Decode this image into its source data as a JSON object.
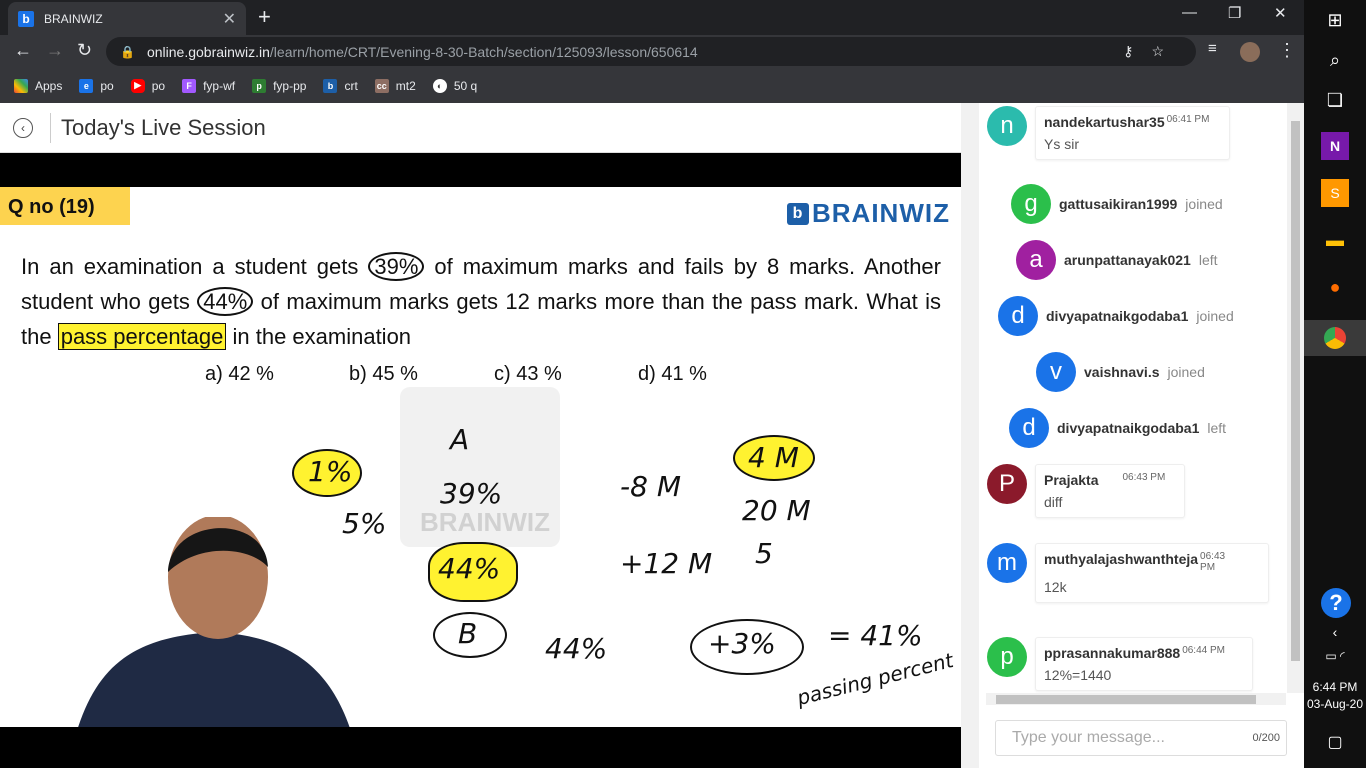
{
  "browser": {
    "tab_title": "BRAINWIZ",
    "tab_close": "✕",
    "new_tab": "+",
    "win_min": "—",
    "win_max": "❐",
    "win_close": "✕",
    "url_domain": "online.gobrainwiz.in",
    "url_path": "/learn/home/CRT/Evening-8-30-Batch/section/125093/lesson/650614",
    "bookmarks": [
      {
        "label": "Apps",
        "color": "#ea4335"
      },
      {
        "label": "po",
        "color": "#1a73e8"
      },
      {
        "label": "po",
        "color": "#ff0000"
      },
      {
        "label": "fyp-wf",
        "color": "#a259ff"
      },
      {
        "label": "fyp-pp",
        "color": "#2e7d32"
      },
      {
        "label": "crt",
        "color": "#1d5fa8"
      },
      {
        "label": "mt2",
        "color": "#8d6e63"
      },
      {
        "label": "50 q",
        "color": "#ffffff"
      }
    ]
  },
  "page": {
    "title": "Today's Live Session"
  },
  "board": {
    "qno": "Q no (19)",
    "brand": "BRAINWIZ",
    "q_pre": "In an examination a student gets ",
    "q_p1": "39%",
    "q_mid1": " of maximum marks and fails by 8 marks. Another student who gets ",
    "q_p2": "44%",
    "q_mid2": " of maximum marks gets 12 marks more than the pass mark. What is the ",
    "q_hl": "pass percentage",
    "q_end": " in the examination",
    "opt_a": "a) 42 %",
    "opt_b": "b) 45 %",
    "opt_c": "c) 43 %",
    "opt_d": "d) 41 %",
    "wm_text": "BRAINWIZ",
    "hand": {
      "a": "A",
      "p39": "39%",
      "p1": "1%",
      "p5": "5%",
      "p44": "44%",
      "b": "B",
      "p44b": "44%",
      "m8": "-8 M",
      "m4": "4 M",
      "m20": "20 M",
      "five": "5",
      "m12": "+12 M",
      "p3": "+3%",
      "eq": "= 41%",
      "passing": "passing percent"
    }
  },
  "chat": {
    "messages": [
      {
        "type": "msg",
        "avatar": "n",
        "color": "#2bbbad",
        "name": "nandekartushar35",
        "time": "06:41 PM",
        "text": "Ys sir"
      },
      {
        "type": "join",
        "avatar": "g",
        "color": "#2bbf4b",
        "name": "gattusaikiran1999",
        "status": "joined"
      },
      {
        "type": "join",
        "avatar": "a",
        "color": "#a020a0",
        "name": "arunpattanayak021",
        "status": "left"
      },
      {
        "type": "join",
        "avatar": "d",
        "color": "#1a73e8",
        "name": "divyapatnaikgodaba1",
        "status": "joined"
      },
      {
        "type": "join",
        "avatar": "v",
        "color": "#1a73e8",
        "name": "vaishnavi.s",
        "status": "joined"
      },
      {
        "type": "join",
        "avatar": "d",
        "color": "#1a73e8",
        "name": "divyapatnaikgodaba1",
        "status": "left"
      },
      {
        "type": "msg",
        "avatar": "P",
        "color": "#8b1a2b",
        "name": "Prajakta",
        "time": "06:43 PM",
        "text": "diff"
      },
      {
        "type": "msg",
        "avatar": "m",
        "color": "#1a73e8",
        "name": "muthyalajashwanthteja",
        "time": "06:43 PM",
        "text": "12k"
      },
      {
        "type": "msg",
        "avatar": "p",
        "color": "#2bbf4b",
        "name": "pprasannakumar888",
        "time": "06:44 PM",
        "text": "12%=1440"
      }
    ],
    "input_placeholder": "Type your message...",
    "char_count": "0/200"
  },
  "taskbar": {
    "time": "6:44 PM",
    "date": "03-Aug-20"
  }
}
